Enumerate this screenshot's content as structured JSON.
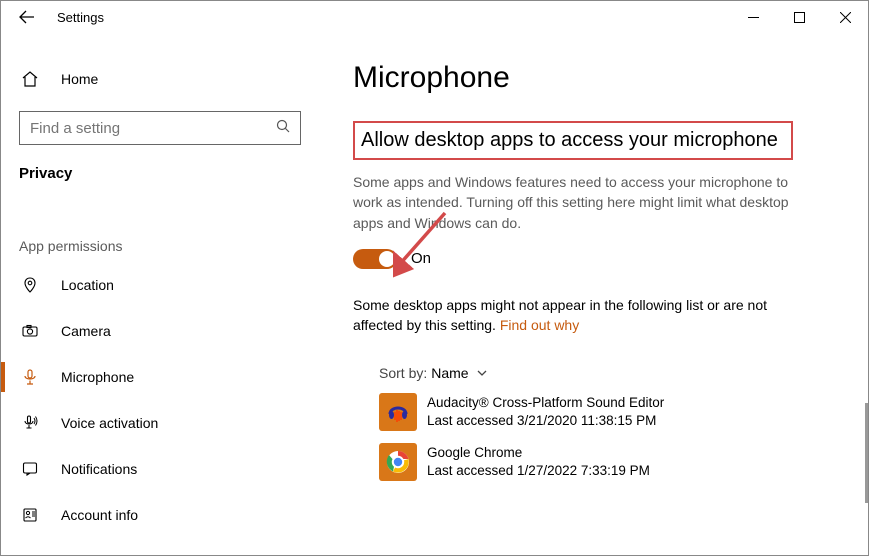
{
  "window": {
    "title": "Settings"
  },
  "sidebar": {
    "home_label": "Home",
    "search_placeholder": "Find a setting",
    "category_label": "Privacy",
    "section_label": "App permissions",
    "items": [
      {
        "label": "Location"
      },
      {
        "label": "Camera"
      },
      {
        "label": "Microphone"
      },
      {
        "label": "Voice activation"
      },
      {
        "label": "Notifications"
      },
      {
        "label": "Account info"
      }
    ]
  },
  "content": {
    "page_title": "Microphone",
    "allow_heading": "Allow desktop apps to access your microphone",
    "description": "Some apps and Windows features need to access your microphone to work as intended. Turning off this setting here might limit what desktop apps and Windows can do.",
    "toggle": {
      "state": "On"
    },
    "note_text": "Some desktop apps might not appear in the following list or are not affected by this setting. ",
    "note_link": "Find out why",
    "sort": {
      "label": "Sort by:",
      "value": "Name"
    },
    "apps": [
      {
        "name": "Audacity® Cross-Platform Sound Editor",
        "last": "Last accessed 3/21/2020 11:38:15 PM"
      },
      {
        "name": "Google Chrome",
        "last": "Last accessed 1/27/2022 7:33:19 PM"
      }
    ]
  }
}
